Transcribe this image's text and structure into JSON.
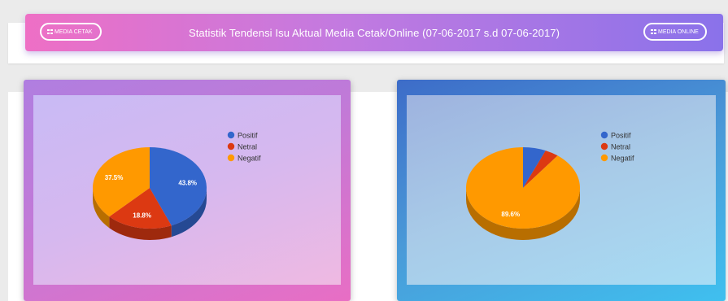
{
  "header": {
    "title": "Statistik Tendensi Isu Aktual Media Cetak/Online (07-06-2017 s.d 07-06-2017)",
    "left_button": "MEDIA CETAK",
    "right_button": "MEDIA ONLINE",
    "button_icon": "grid-icon"
  },
  "colors": {
    "positif": "#3366cc",
    "netral": "#dc3912",
    "negatif": "#ff9900"
  },
  "chart_data": [
    {
      "type": "pie",
      "legend": [
        "Positif",
        "Netral",
        "Negatif"
      ],
      "legend_position": "right",
      "values": [
        43.8,
        18.8,
        37.5
      ],
      "labels": [
        "43.8%",
        "18.8%",
        "37.5%"
      ]
    },
    {
      "type": "pie",
      "legend": [
        "Positif",
        "Netral",
        "Negatif"
      ],
      "legend_position": "right",
      "values": [
        6.5,
        3.9,
        89.6
      ],
      "labels": [
        "",
        "",
        "89.6%"
      ]
    }
  ]
}
